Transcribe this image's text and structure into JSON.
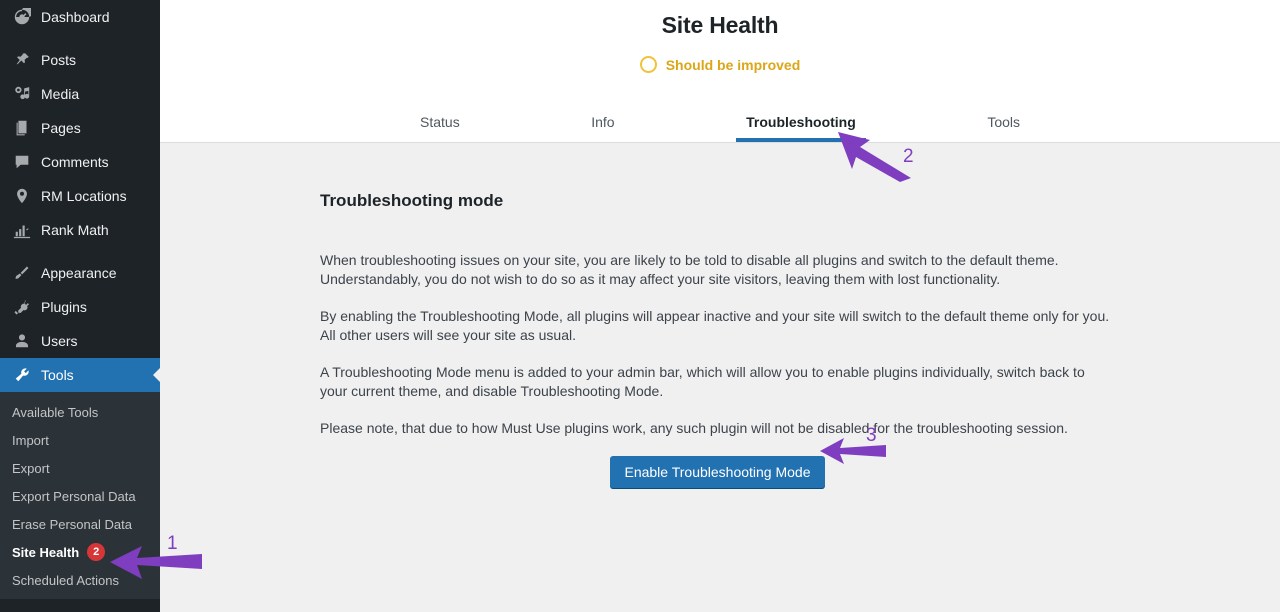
{
  "sidebar": {
    "menu": [
      {
        "label": "Dashboard",
        "icon": "dashboard-icon",
        "current": false,
        "gap": false
      },
      {
        "label": "Posts",
        "icon": "pin-icon",
        "current": false,
        "gap": true
      },
      {
        "label": "Media",
        "icon": "media-icon",
        "current": false,
        "gap": false
      },
      {
        "label": "Pages",
        "icon": "pages-icon",
        "current": false,
        "gap": false
      },
      {
        "label": "Comments",
        "icon": "comments-icon",
        "current": false,
        "gap": false
      },
      {
        "label": "RM Locations",
        "icon": "location-pin-icon",
        "current": false,
        "gap": false
      },
      {
        "label": "Rank Math",
        "icon": "chart-bars-icon",
        "current": false,
        "gap": false
      },
      {
        "label": "Appearance",
        "icon": "appearance-brush-icon",
        "current": false,
        "gap": true
      },
      {
        "label": "Plugins",
        "icon": "plug-icon",
        "current": false,
        "gap": false
      },
      {
        "label": "Users",
        "icon": "user-icon",
        "current": false,
        "gap": false
      },
      {
        "label": "Tools",
        "icon": "wrench-icon",
        "current": true,
        "gap": false
      }
    ],
    "submenu": [
      {
        "label": "Available Tools",
        "active": false,
        "badge": null
      },
      {
        "label": "Import",
        "active": false,
        "badge": null
      },
      {
        "label": "Export",
        "active": false,
        "badge": null
      },
      {
        "label": "Export Personal Data",
        "active": false,
        "badge": null
      },
      {
        "label": "Erase Personal Data",
        "active": false,
        "badge": null
      },
      {
        "label": "Site Health",
        "active": true,
        "badge": "2"
      },
      {
        "label": "Scheduled Actions",
        "active": false,
        "badge": null
      }
    ]
  },
  "header": {
    "title": "Site Health",
    "status_label": "Should be improved",
    "status_icon": "status-ring-icon",
    "status_color": "#dba617",
    "tabs": [
      {
        "label": "Status",
        "active": false
      },
      {
        "label": "Info",
        "active": false
      },
      {
        "label": "Troubleshooting",
        "active": true
      },
      {
        "label": "Tools",
        "active": false
      }
    ],
    "accent_color": "#2271b1"
  },
  "main": {
    "section_title": "Troubleshooting mode",
    "paragraphs": [
      "When troubleshooting issues on your site, you are likely to be told to disable all plugins and switch to the default theme. Understandably, you do not wish to do so as it may affect your site visitors, leaving them with lost functionality.",
      "By enabling the Troubleshooting Mode, all plugins will appear inactive and your site will switch to the default theme only for you. All other users will see your site as usual.",
      "A Troubleshooting Mode menu is added to your admin bar, which will allow you to enable plugins individually, switch back to your current theme, and disable Troubleshooting Mode.",
      "Please note, that due to how Must Use plugins work, any such plugin will not be disabled for the troubleshooting session."
    ],
    "enable_button": "Enable Troubleshooting Mode",
    "button_color": "#2271b1"
  },
  "annotations": {
    "color": "#7e3ebf",
    "steps": [
      {
        "number": "1",
        "target": "sidebar-item-site-health"
      },
      {
        "number": "2",
        "target": "tab-troubleshooting"
      },
      {
        "number": "3",
        "target": "enable-troubleshooting-button"
      }
    ]
  }
}
